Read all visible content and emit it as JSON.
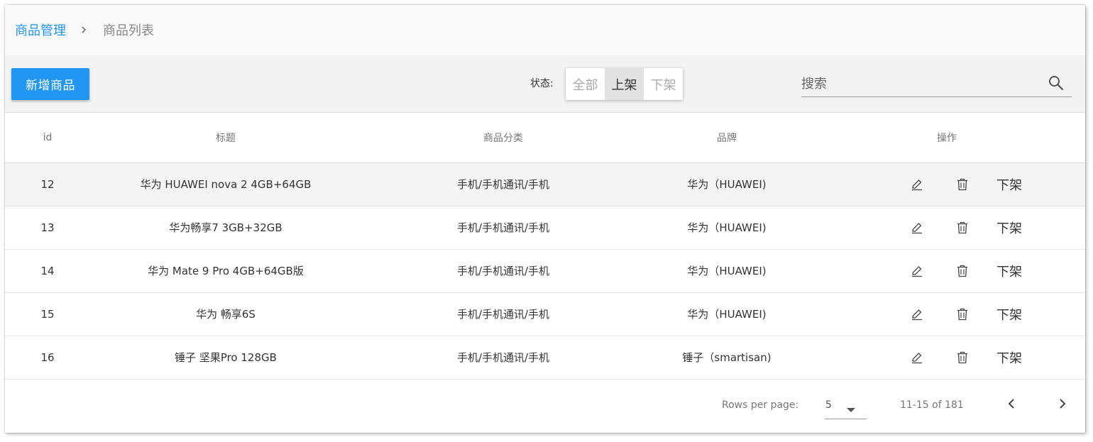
{
  "breadcrumb": {
    "parent": "商品管理",
    "current": "商品列表"
  },
  "toolbar": {
    "add_label": "新增商品",
    "status_label": "状态:",
    "status_options": [
      "全部",
      "上架",
      "下架"
    ],
    "status_selected": "上架",
    "search_placeholder": "搜索"
  },
  "table": {
    "columns": [
      "id",
      "标题",
      "商品分类",
      "品牌",
      "操作"
    ],
    "rows": [
      {
        "id": "12",
        "title": "华为 HUAWEI nova 2 4GB+64GB",
        "category": "手机/手机通讯/手机",
        "brand": "华为（HUAWEI)",
        "action": "下架"
      },
      {
        "id": "13",
        "title": "华为畅享7 3GB+32GB",
        "category": "手机/手机通讯/手机",
        "brand": "华为（HUAWEI)",
        "action": "下架"
      },
      {
        "id": "14",
        "title": "华为 Mate 9 Pro 4GB+64GB版",
        "category": "手机/手机通讯/手机",
        "brand": "华为（HUAWEI)",
        "action": "下架"
      },
      {
        "id": "15",
        "title": "华为 畅享6S",
        "category": "手机/手机通讯/手机",
        "brand": "华为（HUAWEI)",
        "action": "下架"
      },
      {
        "id": "16",
        "title": "锤子 坚果Pro 128GB",
        "category": "手机/手机通讯/手机",
        "brand": "锤子（smartisan)",
        "action": "下架"
      }
    ]
  },
  "pagination": {
    "rows_per_page_label": "Rows per page:",
    "rows_per_page": "5",
    "range": "11-15 of 181"
  },
  "colors": {
    "accent": "#2196f3",
    "active_status_bg": "#e2e2e2",
    "highlight_row_bg": "#f5f5f5"
  },
  "icons": {
    "breadcrumb_separator": "chevron-right-icon",
    "search": "search-icon",
    "edit": "pencil-icon",
    "delete": "trash-icon",
    "rows_dropdown": "caret-down-icon",
    "prev_page": "chevron-left-icon",
    "next_page": "chevron-right-icon"
  }
}
